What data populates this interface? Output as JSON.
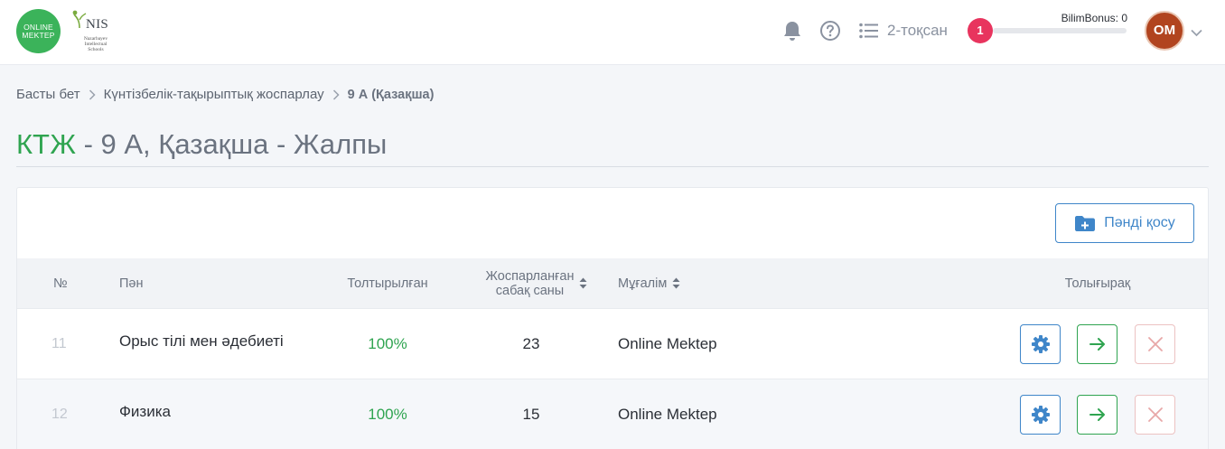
{
  "header": {
    "logo_online_mektep": "ONLINE MEKTEP",
    "logo_nis": "NIS",
    "logo_nis_sub": "Nazarbayev Intellectual Schools",
    "quarter_label": "2-тоқсан",
    "notification_count": "1",
    "bonus_label": "BilimBonus: 0",
    "avatar_initials": "OM"
  },
  "breadcrumb": {
    "home": "Басты бет",
    "planning": "Күнтізбелік-тақырыптық жоспарлау",
    "current": "9 А (Қазақша)"
  },
  "title": {
    "accent": "КТЖ",
    "rest": " - 9 А, Қазақша - Жалпы"
  },
  "toolbar": {
    "add_subject_label": "Пәнді қосу"
  },
  "table": {
    "columns": {
      "num": "№",
      "subject": "Пән",
      "filled": "Толтырылған",
      "planned_1": "Жоспарланған",
      "planned_2": "сабақ саны",
      "teacher": "Мұғалім",
      "actions": "Толығырақ"
    },
    "rows": [
      {
        "num": "11",
        "subject": "Орыс тілі мен әдебиеті",
        "filled": "100%",
        "planned": "23",
        "teacher": "Online Mektep"
      },
      {
        "num": "12",
        "subject": "Физика",
        "filled": "100%",
        "planned": "15",
        "teacher": "Online Mektep"
      }
    ]
  },
  "colors": {
    "accent_green": "#2fa450",
    "accent_blue": "#3f86c9",
    "badge_red": "#e8345e",
    "avatar_bg": "#b1441f"
  },
  "icons": [
    "bell-icon",
    "help-icon",
    "list-icon",
    "chevron-down-icon",
    "folder-plus-icon",
    "gear-icon",
    "arrow-right-icon",
    "close-icon"
  ]
}
